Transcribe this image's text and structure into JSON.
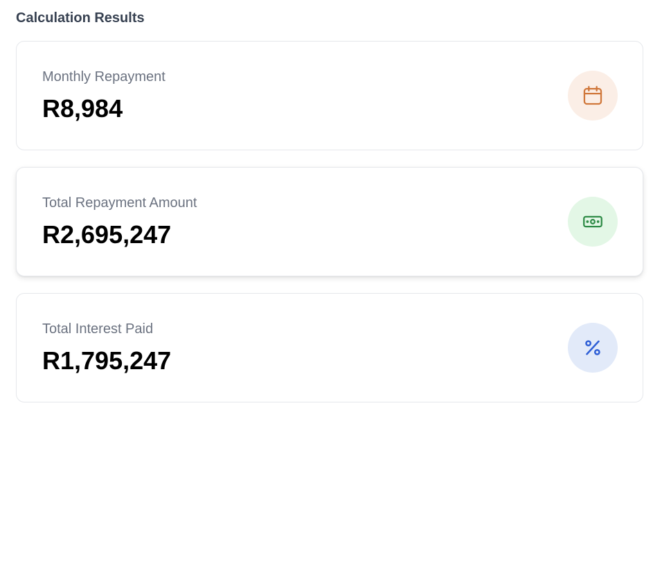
{
  "section": {
    "title": "Calculation Results"
  },
  "cards": [
    {
      "label": "Monthly Repayment",
      "value": "R8,984",
      "icon": "calendar-icon",
      "icon_color": "#d0773a",
      "icon_bg": "#fbeee6"
    },
    {
      "label": "Total Repayment Amount",
      "value": "R2,695,247",
      "icon": "banknote-icon",
      "icon_color": "#2e8b46",
      "icon_bg": "#e3f7e6"
    },
    {
      "label": "Total Interest Paid",
      "value": "R1,795,247",
      "icon": "percent-icon",
      "icon_color": "#2f5fd6",
      "icon_bg": "#e2eaf9"
    }
  ]
}
